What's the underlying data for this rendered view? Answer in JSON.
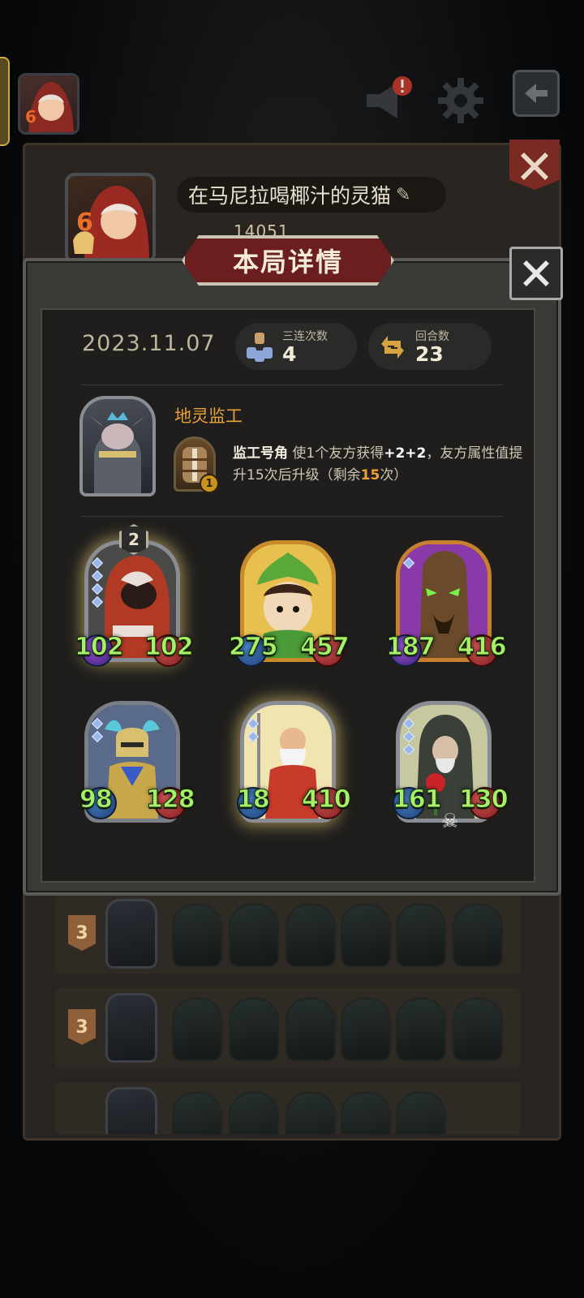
{
  "profile": {
    "nickname": "在马尼拉喝椰汁的灵猫",
    "score": "14051",
    "portrait_badge": "6"
  },
  "modal": {
    "title": "本局详情",
    "date": "2023.11.07",
    "stats": [
      {
        "label": "三连次数",
        "value": "4"
      },
      {
        "label": "回合数",
        "value": "23"
      }
    ],
    "hero": {
      "name": "地灵监工",
      "skill_name": "监工号角",
      "skill_text_1": " 使1个友方获得",
      "skill_bonus": "+2+2",
      "skill_text_2": "，友方属性值提升15次后升级（剩余",
      "skill_remaining": "15",
      "skill_text_3": "次）",
      "skill_level": "1"
    },
    "cards": [
      {
        "name": "red-hooded-assassin",
        "level": "2",
        "attack": "102",
        "health": "102"
      },
      {
        "name": "leaf-sprite",
        "attack": "275",
        "health": "457"
      },
      {
        "name": "haunted-treant",
        "attack": "187",
        "health": "416"
      },
      {
        "name": "winged-knight",
        "attack": "98",
        "health": "128"
      },
      {
        "name": "dwarf-elder",
        "attack": "18",
        "health": "410"
      },
      {
        "name": "rose-hermit",
        "attack": "161",
        "health": "130"
      }
    ]
  },
  "history": [
    {
      "rank": "3"
    },
    {
      "rank": "3"
    }
  ],
  "colors": {
    "accent_gold": "#e8a23a",
    "stat_green": "#a8ef6a",
    "title_red": "#6b1e1d"
  }
}
